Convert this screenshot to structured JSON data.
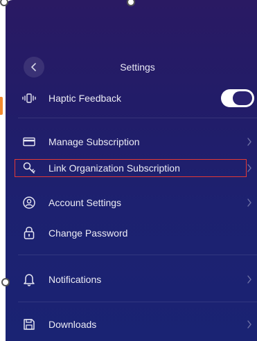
{
  "header": {
    "title": "Settings"
  },
  "rows": {
    "haptic": {
      "label": "Haptic Feedback",
      "toggle_on": true
    },
    "manage_subscription": {
      "label": "Manage Subscription"
    },
    "link_org_subscription": {
      "label": "Link Organization Subscription"
    },
    "account_settings": {
      "label": "Account Settings"
    },
    "change_password": {
      "label": "Change Password"
    },
    "notifications": {
      "label": "Notifications"
    },
    "downloads": {
      "label": "Downloads"
    }
  },
  "icons": {
    "back": "chevron-left-icon",
    "haptic": "vibration-icon",
    "manage_subscription": "credit-card-icon",
    "link_org_subscription": "key-icon",
    "account_settings": "account-circle-icon",
    "change_password": "lock-icon",
    "notifications": "bell-icon",
    "downloads": "save-icon",
    "chevron": "chevron-right-icon"
  },
  "colors": {
    "background_top": "#2a1a63",
    "background_bottom": "#1a2373",
    "text": "#ececf5",
    "highlight": "#e53935",
    "side_tab": "#f28a2e"
  }
}
